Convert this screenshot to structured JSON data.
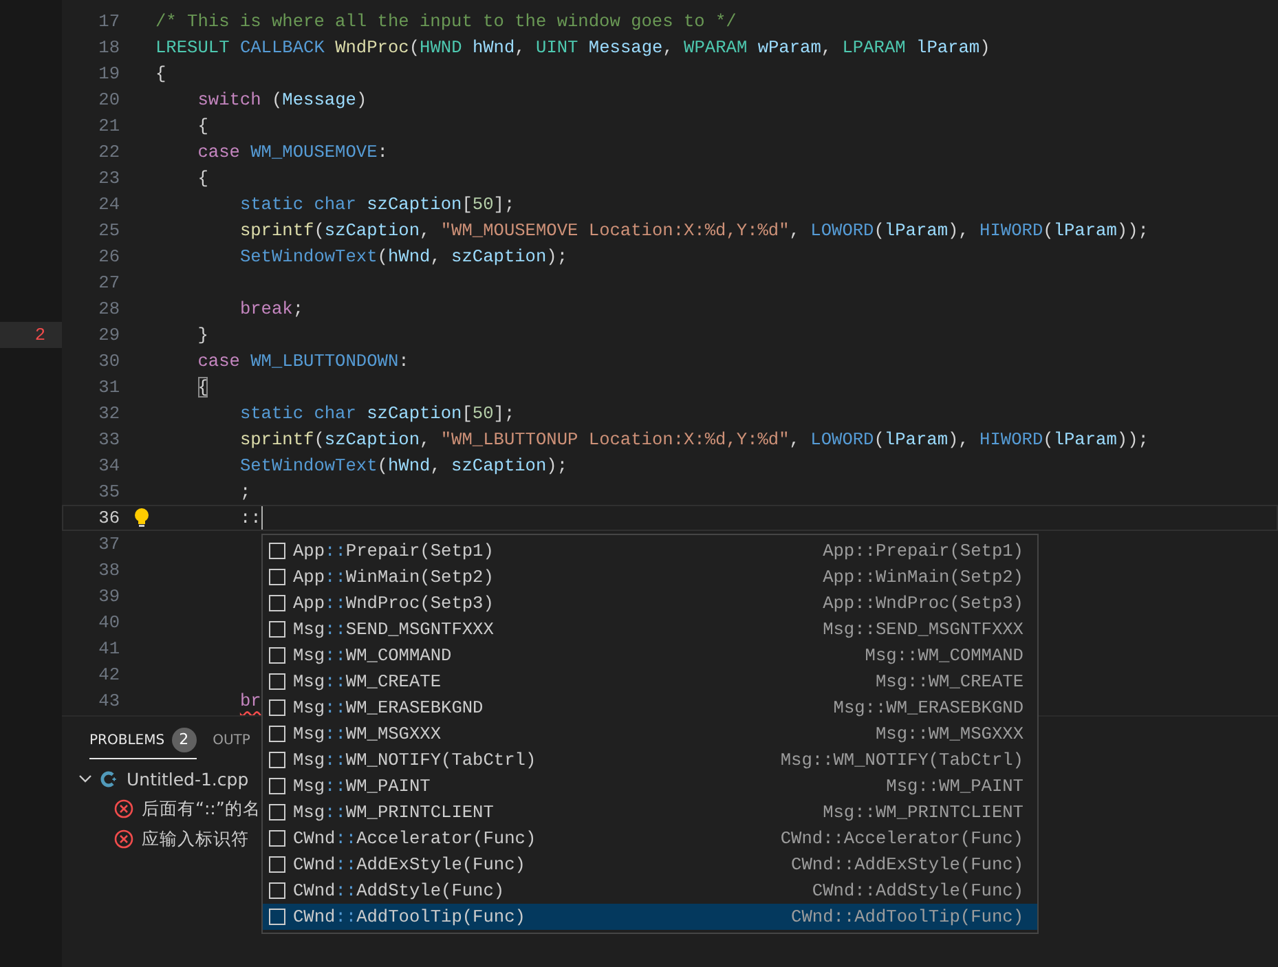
{
  "editor": {
    "lines": [
      {
        "number": "17",
        "current": false,
        "tokens": [
          {
            "text": "/* This is where all the input to the window goes to */",
            "kind": "comment"
          }
        ]
      },
      {
        "number": "18",
        "current": false,
        "tokens": [
          {
            "text": "LRESULT",
            "kind": "type"
          },
          {
            "text": " CALLBACK",
            "kind": "macro"
          },
          {
            "text": " WndProc",
            "kind": "function"
          },
          {
            "text": "(",
            "kind": "plain"
          },
          {
            "text": "HWND",
            "kind": "type"
          },
          {
            "text": " hWnd",
            "kind": "variable"
          },
          {
            "text": ", ",
            "kind": "plain"
          },
          {
            "text": "UINT",
            "kind": "type"
          },
          {
            "text": " Message",
            "kind": "variable"
          },
          {
            "text": ", ",
            "kind": "plain"
          },
          {
            "text": "WPARAM",
            "kind": "type"
          },
          {
            "text": " wParam",
            "kind": "variable"
          },
          {
            "text": ", ",
            "kind": "plain"
          },
          {
            "text": "LPARAM",
            "kind": "type"
          },
          {
            "text": " lParam",
            "kind": "variable"
          },
          {
            "text": ")",
            "kind": "plain"
          }
        ]
      },
      {
        "number": "19",
        "current": false,
        "tokens": [
          {
            "text": "{",
            "kind": "plain"
          }
        ]
      },
      {
        "number": "20",
        "current": false,
        "tokens": [
          {
            "text": "    switch",
            "kind": "keyword"
          },
          {
            "text": " (",
            "kind": "plain"
          },
          {
            "text": "Message",
            "kind": "variable"
          },
          {
            "text": ")",
            "kind": "plain"
          }
        ]
      },
      {
        "number": "21",
        "current": false,
        "tokens": [
          {
            "text": "    {",
            "kind": "plain"
          }
        ]
      },
      {
        "number": "22",
        "current": false,
        "tokens": [
          {
            "text": "    case",
            "kind": "keyword"
          },
          {
            "text": " WM_MOUSEMOVE",
            "kind": "macro"
          },
          {
            "text": ":",
            "kind": "plain"
          }
        ]
      },
      {
        "number": "23",
        "current": false,
        "tokens": [
          {
            "text": "    {",
            "kind": "plain"
          }
        ]
      },
      {
        "number": "24",
        "current": false,
        "tokens": [
          {
            "text": "        static char",
            "kind": "macro"
          },
          {
            "text": " szCaption",
            "kind": "variable"
          },
          {
            "text": "[",
            "kind": "plain"
          },
          {
            "text": "50",
            "kind": "number"
          },
          {
            "text": "];",
            "kind": "plain"
          }
        ]
      },
      {
        "number": "25",
        "current": false,
        "tokens": [
          {
            "text": "        sprintf",
            "kind": "function"
          },
          {
            "text": "(",
            "kind": "plain"
          },
          {
            "text": "szCaption",
            "kind": "variable"
          },
          {
            "text": ", ",
            "kind": "plain"
          },
          {
            "text": "\"WM_MOUSEMOVE Location:X:%d,Y:%d\"",
            "kind": "string"
          },
          {
            "text": ", ",
            "kind": "plain"
          },
          {
            "text": "LOWORD",
            "kind": "macro"
          },
          {
            "text": "(",
            "kind": "plain"
          },
          {
            "text": "lParam",
            "kind": "variable"
          },
          {
            "text": "), ",
            "kind": "plain"
          },
          {
            "text": "HIWORD",
            "kind": "macro"
          },
          {
            "text": "(",
            "kind": "plain"
          },
          {
            "text": "lParam",
            "kind": "variable"
          },
          {
            "text": "));",
            "kind": "plain"
          }
        ]
      },
      {
        "number": "26",
        "current": false,
        "tokens": [
          {
            "text": "        SetWindowText",
            "kind": "macro"
          },
          {
            "text": "(",
            "kind": "plain"
          },
          {
            "text": "hWnd",
            "kind": "variable"
          },
          {
            "text": ", ",
            "kind": "plain"
          },
          {
            "text": "szCaption",
            "kind": "variable"
          },
          {
            "text": ");",
            "kind": "plain"
          }
        ]
      },
      {
        "number": "27",
        "current": false
      },
      {
        "number": "28",
        "current": false,
        "tokens": [
          {
            "text": "        break",
            "kind": "keyword"
          },
          {
            "text": ";",
            "kind": "plain"
          }
        ]
      },
      {
        "number": "29",
        "current": false,
        "marker": "2",
        "tokens": [
          {
            "text": "    }",
            "kind": "plain"
          }
        ]
      },
      {
        "number": "30",
        "current": false,
        "tokens": [
          {
            "text": "    case",
            "kind": "keyword"
          },
          {
            "text": " WM_LBUTTONDOWN",
            "kind": "macro"
          },
          {
            "text": ":",
            "kind": "plain"
          }
        ]
      },
      {
        "number": "31",
        "current": false,
        "tokens": [
          {
            "text": "    {",
            "kind": "bracket-match"
          }
        ]
      },
      {
        "number": "32",
        "current": false,
        "tokens": [
          {
            "text": "        static char",
            "kind": "macro"
          },
          {
            "text": " szCaption",
            "kind": "variable"
          },
          {
            "text": "[",
            "kind": "plain"
          },
          {
            "text": "50",
            "kind": "number"
          },
          {
            "text": "];",
            "kind": "plain"
          }
        ]
      },
      {
        "number": "33",
        "current": false,
        "tokens": [
          {
            "text": "        sprintf",
            "kind": "function"
          },
          {
            "text": "(",
            "kind": "plain"
          },
          {
            "text": "szCaption",
            "kind": "variable"
          },
          {
            "text": ", ",
            "kind": "plain"
          },
          {
            "text": "\"WM_LBUTTONUP Location:X:%d,Y:%d\"",
            "kind": "string"
          },
          {
            "text": ", ",
            "kind": "plain"
          },
          {
            "text": "LOWORD",
            "kind": "macro"
          },
          {
            "text": "(",
            "kind": "plain"
          },
          {
            "text": "lParam",
            "kind": "variable"
          },
          {
            "text": "), ",
            "kind": "plain"
          },
          {
            "text": "HIWORD",
            "kind": "macro"
          },
          {
            "text": "(",
            "kind": "plain"
          },
          {
            "text": "lParam",
            "kind": "variable"
          },
          {
            "text": "));",
            "kind": "plain"
          }
        ]
      },
      {
        "number": "34",
        "current": false,
        "tokens": [
          {
            "text": "        SetWindowText",
            "kind": "macro"
          },
          {
            "text": "(",
            "kind": "plain"
          },
          {
            "text": "hWnd",
            "kind": "variable"
          },
          {
            "text": ", ",
            "kind": "plain"
          },
          {
            "text": "szCaption",
            "kind": "variable"
          },
          {
            "text": ");",
            "kind": "plain"
          }
        ]
      },
      {
        "number": "35",
        "current": false,
        "tokens": [
          {
            "text": "        ;",
            "kind": "plain"
          }
        ]
      },
      {
        "number": "36",
        "current": true,
        "tokens": [
          {
            "text": "        ::",
            "kind": "plain"
          }
        ]
      },
      {
        "number": "37",
        "current": false
      },
      {
        "number": "38",
        "current": false
      },
      {
        "number": "39",
        "current": false
      },
      {
        "number": "40",
        "current": false
      },
      {
        "number": "41",
        "current": false
      },
      {
        "number": "42",
        "current": false
      },
      {
        "number": "43",
        "current": false,
        "tokens": [
          {
            "text": "        br",
            "kind": "keyword",
            "error": true
          }
        ]
      }
    ]
  },
  "suggestions": [
    {
      "scope": "App",
      "separator": "::",
      "member": "Prepair(Setp1)",
      "detail": "App::Prepair(Setp1)",
      "selected": false
    },
    {
      "scope": "App",
      "separator": "::",
      "member": "WinMain(Setp2)",
      "detail": "App::WinMain(Setp2)",
      "selected": false
    },
    {
      "scope": "App",
      "separator": "::",
      "member": "WndProc(Setp3)",
      "detail": "App::WndProc(Setp3)",
      "selected": false
    },
    {
      "scope": "Msg",
      "separator": "::",
      "member": "SEND_MSGNTFXXX",
      "detail": "Msg::SEND_MSGNTFXXX",
      "selected": false
    },
    {
      "scope": "Msg",
      "separator": "::",
      "member": "WM_COMMAND",
      "detail": "Msg::WM_COMMAND",
      "selected": false
    },
    {
      "scope": "Msg",
      "separator": "::",
      "member": "WM_CREATE",
      "detail": "Msg::WM_CREATE",
      "selected": false
    },
    {
      "scope": "Msg",
      "separator": "::",
      "member": "WM_ERASEBKGND",
      "detail": "Msg::WM_ERASEBKGND",
      "selected": false
    },
    {
      "scope": "Msg",
      "separator": "::",
      "member": "WM_MSGXXX",
      "detail": "Msg::WM_MSGXXX",
      "selected": false
    },
    {
      "scope": "Msg",
      "separator": "::",
      "member": "WM_NOTIFY(TabCtrl)",
      "detail": "Msg::WM_NOTIFY(TabCtrl)",
      "selected": false
    },
    {
      "scope": "Msg",
      "separator": "::",
      "member": "WM_PAINT",
      "detail": "Msg::WM_PAINT",
      "selected": false
    },
    {
      "scope": "Msg",
      "separator": "::",
      "member": "WM_PRINTCLIENT",
      "detail": "Msg::WM_PRINTCLIENT",
      "selected": false
    },
    {
      "scope": "CWnd",
      "separator": "::",
      "member": "Accelerator(Func)",
      "detail": "CWnd::Accelerator(Func)",
      "selected": false
    },
    {
      "scope": "CWnd",
      "separator": "::",
      "member": "AddExStyle(Func)",
      "detail": "CWnd::AddExStyle(Func)",
      "selected": false
    },
    {
      "scope": "CWnd",
      "separator": "::",
      "member": "AddStyle(Func)",
      "detail": "CWnd::AddStyle(Func)",
      "selected": false
    },
    {
      "scope": "CWnd",
      "separator": "::",
      "member": "AddToolTip(Func)",
      "detail": "CWnd::AddToolTip(Func)",
      "selected": true
    }
  ],
  "panel": {
    "tabs": [
      {
        "label": "PROBLEMS",
        "badge": "2",
        "selected": true
      },
      {
        "label": "OUTP",
        "selected": false
      }
    ],
    "problems": [
      {
        "file": "Untitled-1.cpp",
        "expanded": true,
        "children": [
          {
            "message": "后面有“::”的名"
          },
          {
            "message": "应输入标识符"
          }
        ]
      }
    ]
  }
}
